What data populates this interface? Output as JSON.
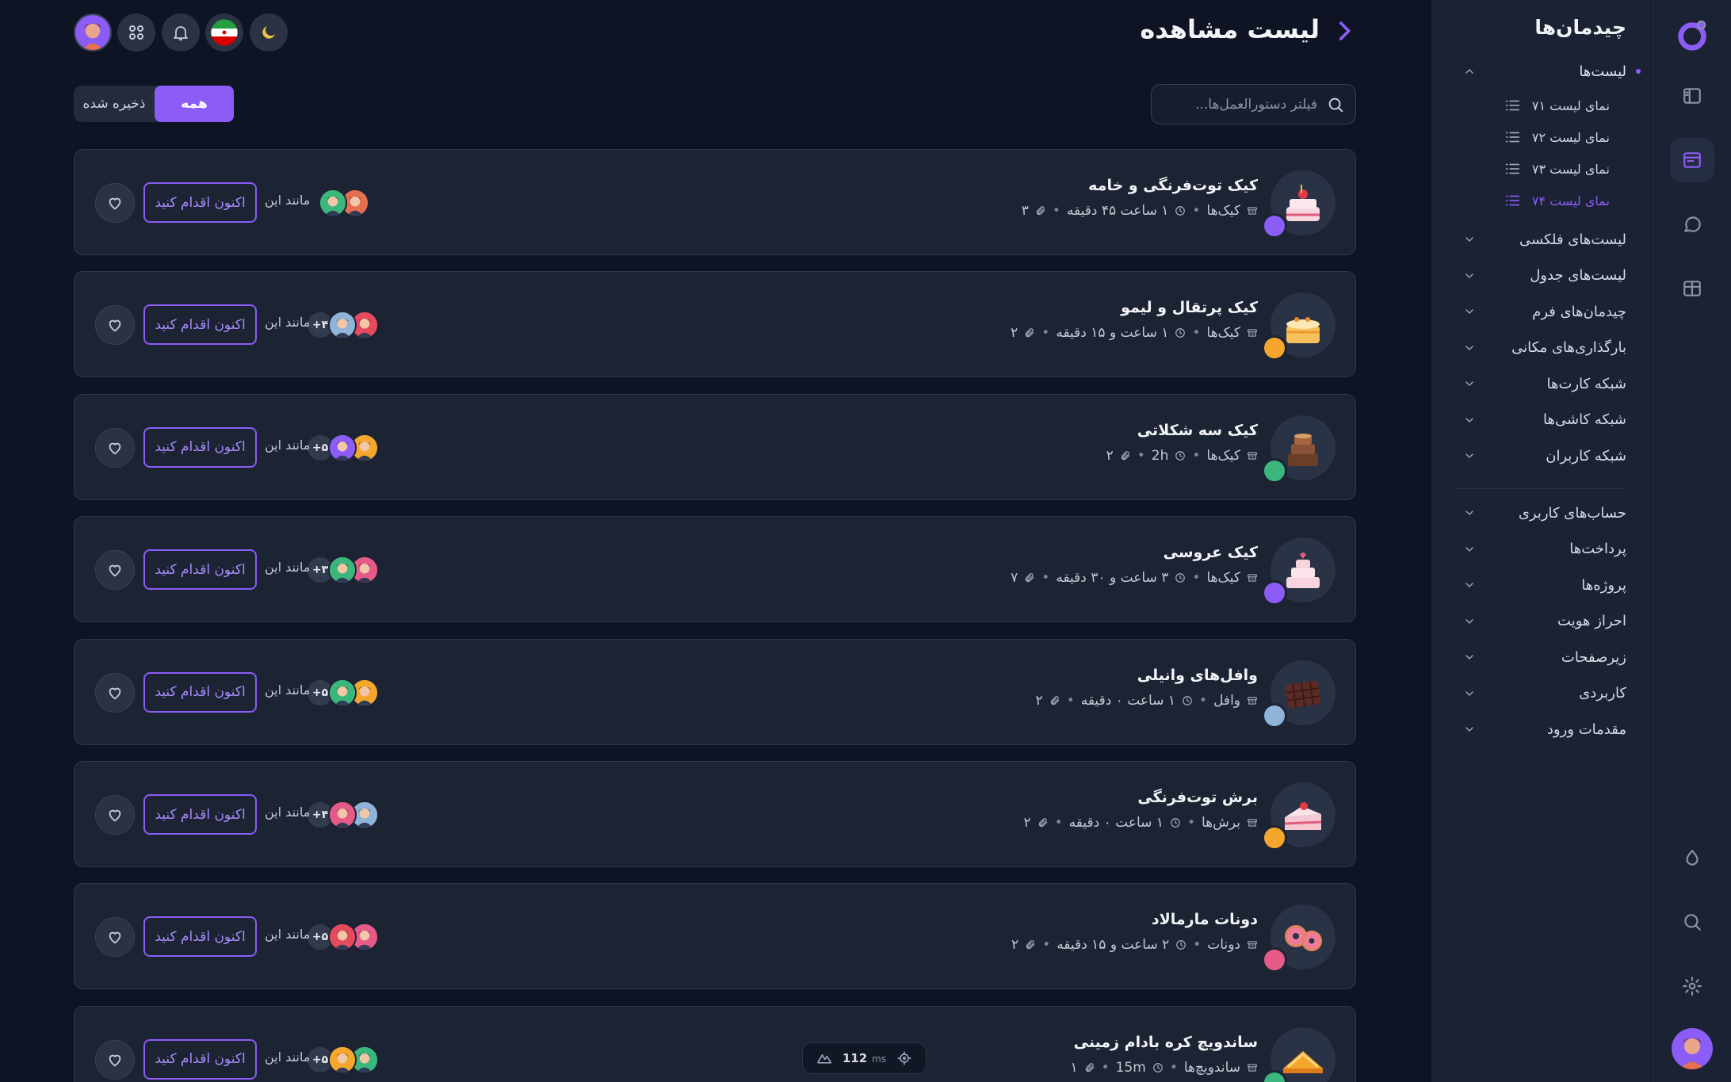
{
  "header": {
    "title": "لیست مشاهده"
  },
  "search": {
    "placeholder": "فیلتر دستورالعمل‌ها..."
  },
  "filters": {
    "all": "همه",
    "saved": "ذخیره شده"
  },
  "sidebar": {
    "title": "چیدمان‌ها",
    "lists_label": "لیست‌ها",
    "list_items": [
      "نمای لیست ۷۱",
      "نمای لیست ۷۲",
      "نمای لیست ۷۳",
      "نمای لیست ۷۴"
    ],
    "sections": [
      "لیست‌های فلکسی",
      "لیست‌های جدول",
      "چیدمان‌های فرم",
      "بارگذاری‌های مکانی",
      "شبکه کارت‌ها",
      "شبکه کاشی‌ها",
      "شبکه کاربران"
    ],
    "sections2": [
      "حساب‌های کاربری",
      "پرداخت‌ها",
      "پروژه‌ها",
      "احراز هویت",
      "زیرصفحات",
      "کاربردی",
      "مقدمات ورود"
    ]
  },
  "card_common": {
    "action": "اکنون اقدام کنید",
    "likes": "مانند این"
  },
  "recipes": [
    {
      "title": "کیک توت‌فرنگی و خامه",
      "category": "کیک‌ها",
      "time": "۱ ساعت ۴۵ دقیقه",
      "attachments": "۳",
      "extra": "",
      "icon": "cake-strawberry-icon"
    },
    {
      "title": "کیک پرتقال و لیمو",
      "category": "کیک‌ها",
      "time": "۱ ساعت و ۱۵ دقیقه",
      "attachments": "۲",
      "extra": "+۴",
      "icon": "cake-orange-icon"
    },
    {
      "title": "کیک سه شکلاتی",
      "category": "کیک‌ها",
      "time": "2h",
      "attachments": "۲",
      "extra": "+۵",
      "icon": "cake-chocolate-icon"
    },
    {
      "title": "کیک عروسی",
      "category": "کیک‌ها",
      "time": "۳ ساعت و ۳۰ دقیقه",
      "attachments": "۷",
      "extra": "+۳",
      "icon": "cake-wedding-icon"
    },
    {
      "title": "وافل‌های وانیلی",
      "category": "وافل",
      "time": "۱ ساعت ۰ دقیقه",
      "attachments": "۲",
      "extra": "+۵",
      "icon": "waffle-icon"
    },
    {
      "title": "برش توت‌فرنگی",
      "category": "برش‌ها",
      "time": "۱ ساعت ۰ دقیقه",
      "attachments": "۲",
      "extra": "+۴",
      "icon": "cake-slice-icon"
    },
    {
      "title": "دونات مارمالاد",
      "category": "دونات",
      "time": "۲ ساعت و ۱۵ دقیقه",
      "attachments": "۲",
      "extra": "+۵",
      "icon": "donut-icon"
    },
    {
      "title": "ساندویچ کره بادام زمینی",
      "category": "ساندویچ‌ها",
      "time": "15m",
      "attachments": "۱",
      "extra": "+۵",
      "icon": "sandwich-icon"
    }
  ],
  "devtools": {
    "ms": "112",
    "unit": "ms"
  },
  "colors": {
    "accent": "#8b5cf6",
    "bg": "#0e1424",
    "card": "#1c2333",
    "sidebar": "#1b2233"
  }
}
